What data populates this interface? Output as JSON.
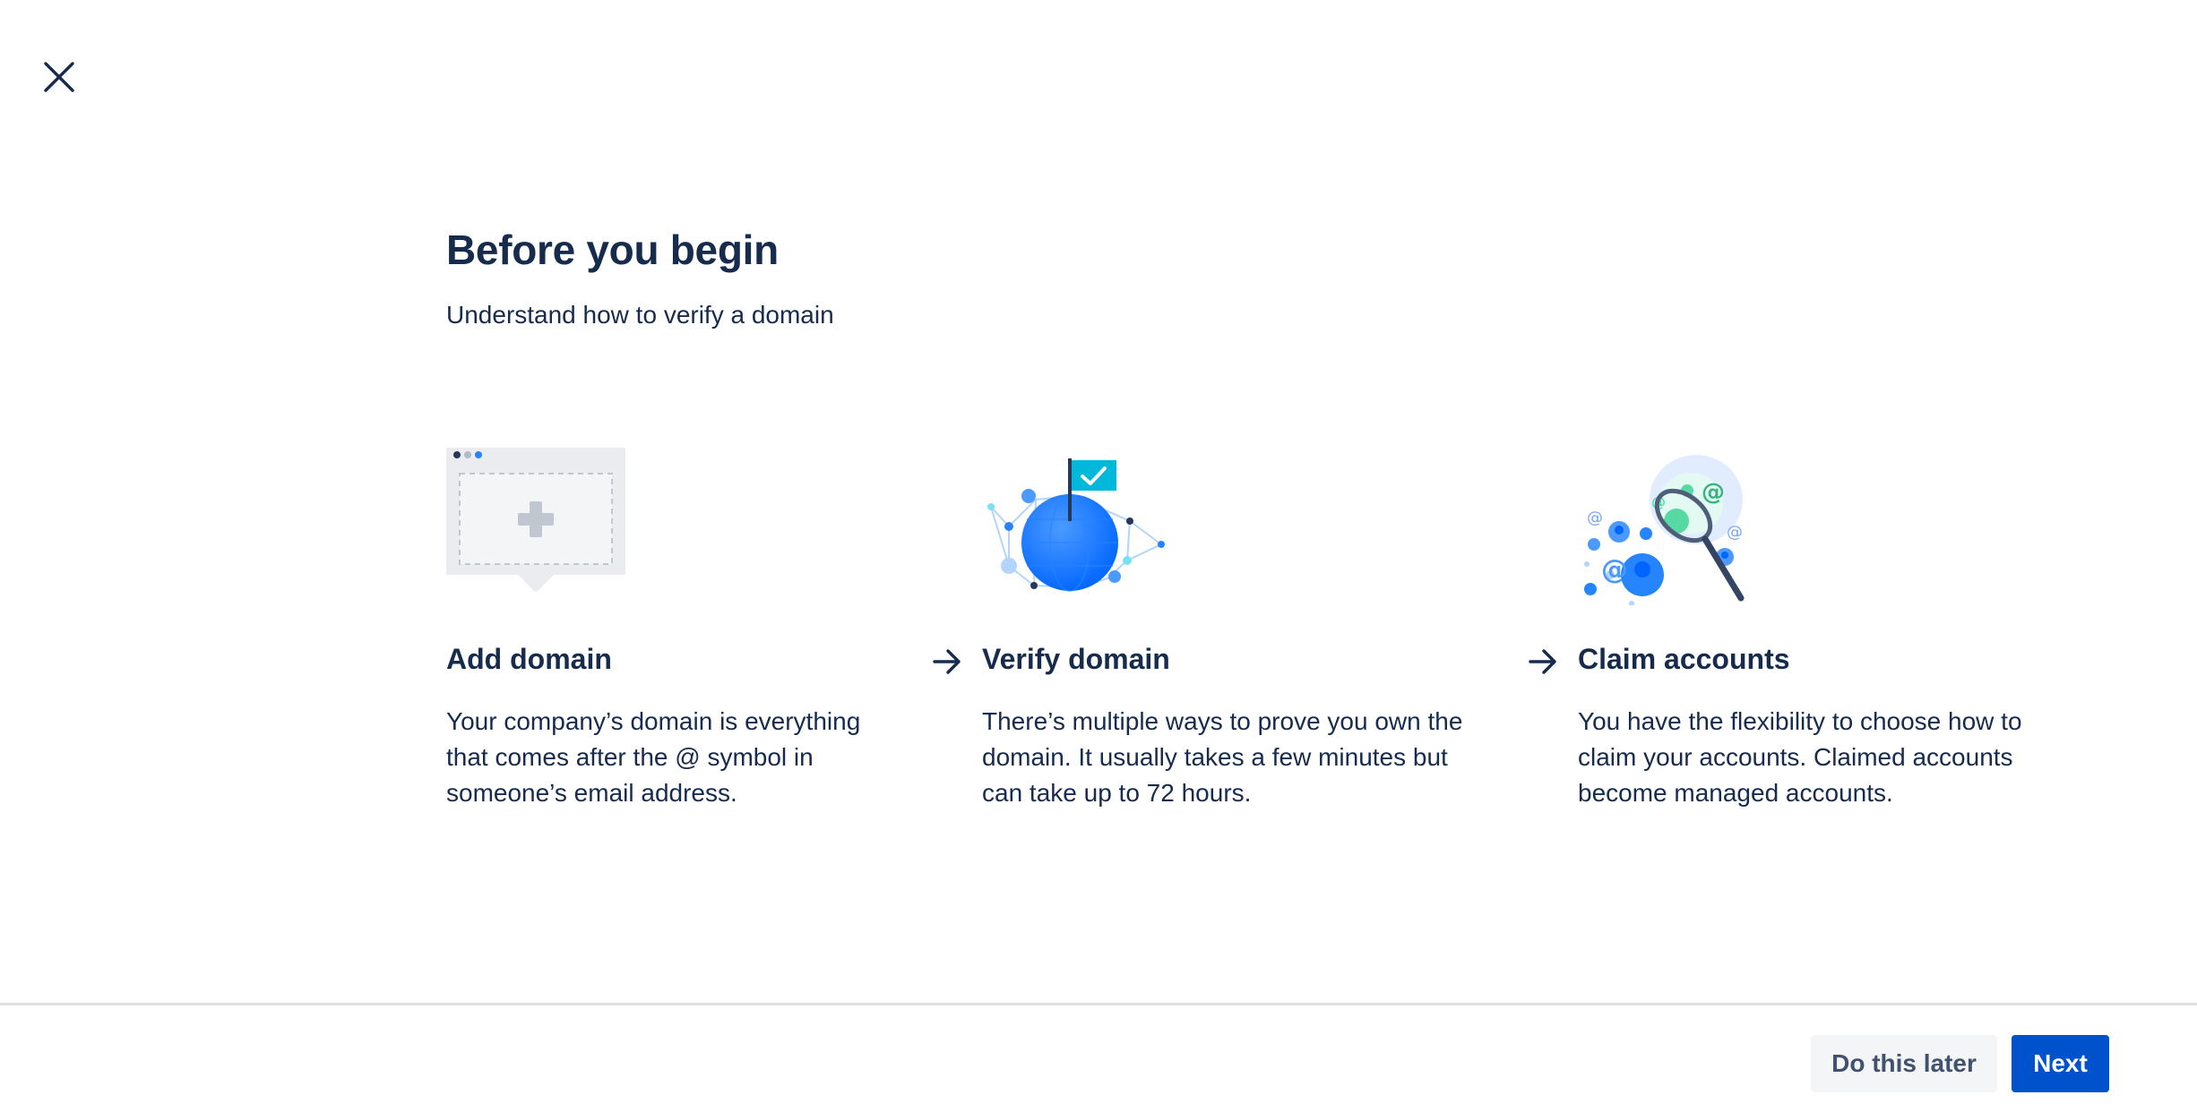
{
  "header": {
    "close_icon": "close-icon",
    "title": "Before you begin",
    "subtitle": "Understand how to verify a domain"
  },
  "steps": [
    {
      "title": "Add domain",
      "description": "Your company’s domain is everything that comes after the @ symbol in someone’s email address.",
      "icon": "add-domain-illustration"
    },
    {
      "title": "Verify domain",
      "description": "There’s multiple ways to prove you own the domain. It usually takes a few minutes but can take up to 72 hours.",
      "icon": "verify-domain-globe-illustration"
    },
    {
      "title": "Claim accounts",
      "description": "You have the flexibility to choose how to claim your accounts. Claimed accounts become managed accounts.",
      "icon": "claim-accounts-net-illustration"
    }
  ],
  "footer": {
    "secondary_label": "Do this later",
    "primary_label": "Next"
  },
  "colors": {
    "text": "#172b4d",
    "primary": "#0052cc",
    "secondary_bg": "#f4f5f7",
    "divider": "#dfe1e6"
  }
}
